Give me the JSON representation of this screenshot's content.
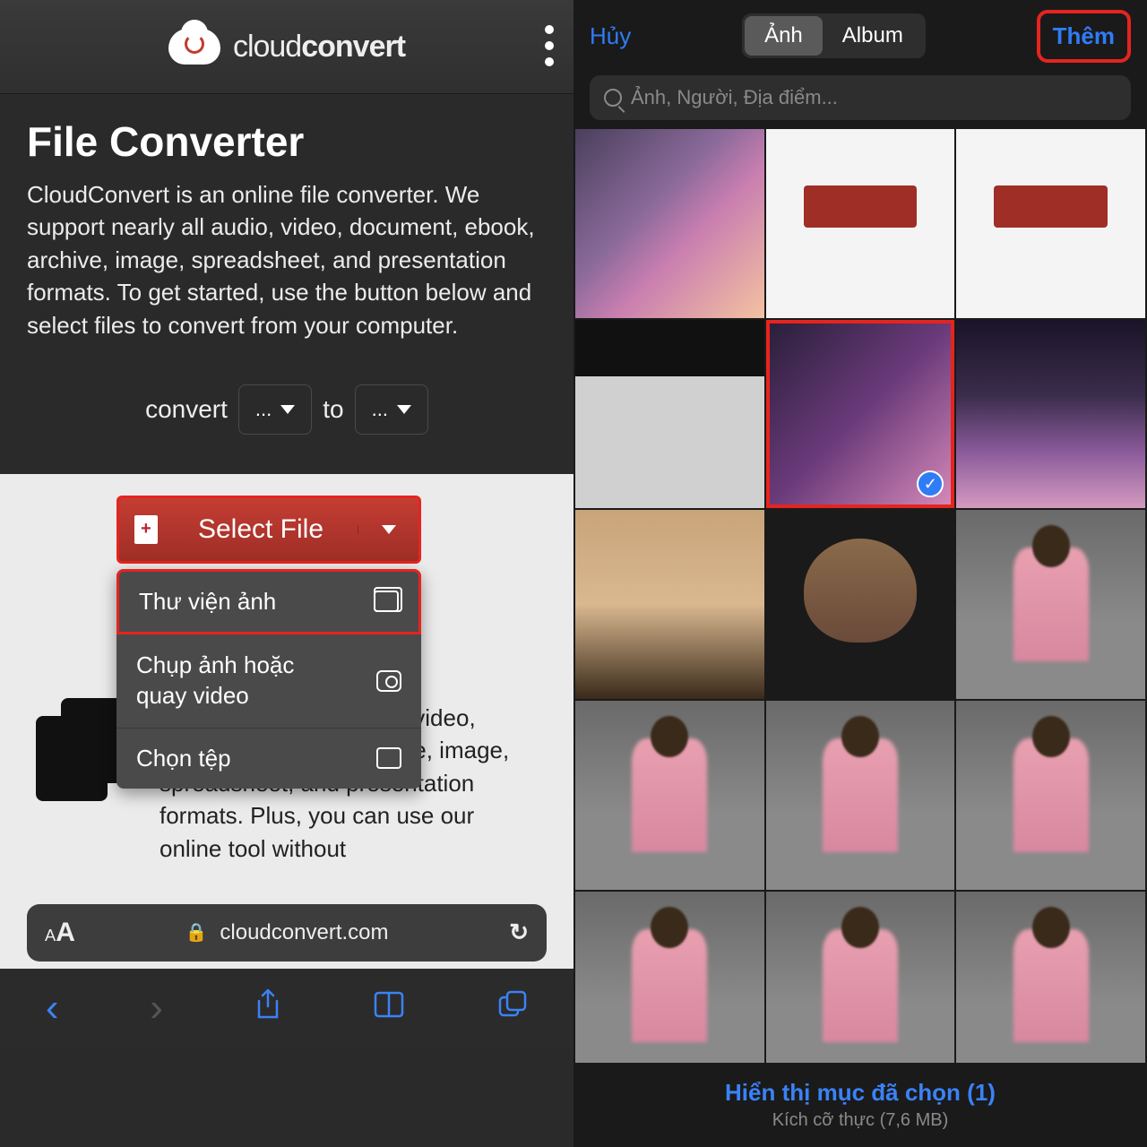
{
  "left": {
    "brand_light": "cloud",
    "brand_bold": "convert",
    "title": "File Converter",
    "description": "CloudConvert is an online file converter. We support nearly all audio, video, document, ebook, archive, image, spreadsheet, and presentation formats. To get started, use the button below and select files to convert from your computer.",
    "convert_label": "convert",
    "to_label": "to",
    "dots": "...",
    "select_file": "Select File",
    "menu": {
      "photo_library": "Thư viện ảnh",
      "camera": "Chụp ảnh hoặc quay video",
      "choose_file": "Chọn tệp"
    },
    "bg_paragraph": "support nearly all audio, video, document, ebook, archive, image, spreadsheet, and presentation formats. Plus, you can use our online tool without",
    "url_domain": "cloudconvert.com"
  },
  "right": {
    "cancel": "Hủy",
    "tab_photos": "Ảnh",
    "tab_albums": "Album",
    "add": "Thêm",
    "search_placeholder": "Ảnh, Người, Địa điểm...",
    "footer_selected": "Hiển thị mục đã chọn (1)",
    "footer_size": "Kích cỡ thực (7,6 MB)"
  },
  "icons": {
    "back": "‹",
    "forward": "›",
    "share": "↑",
    "bookmarks": "▭▭",
    "tabs": "⧉",
    "reload": "↻",
    "lock": "🔒",
    "check": "✓"
  }
}
